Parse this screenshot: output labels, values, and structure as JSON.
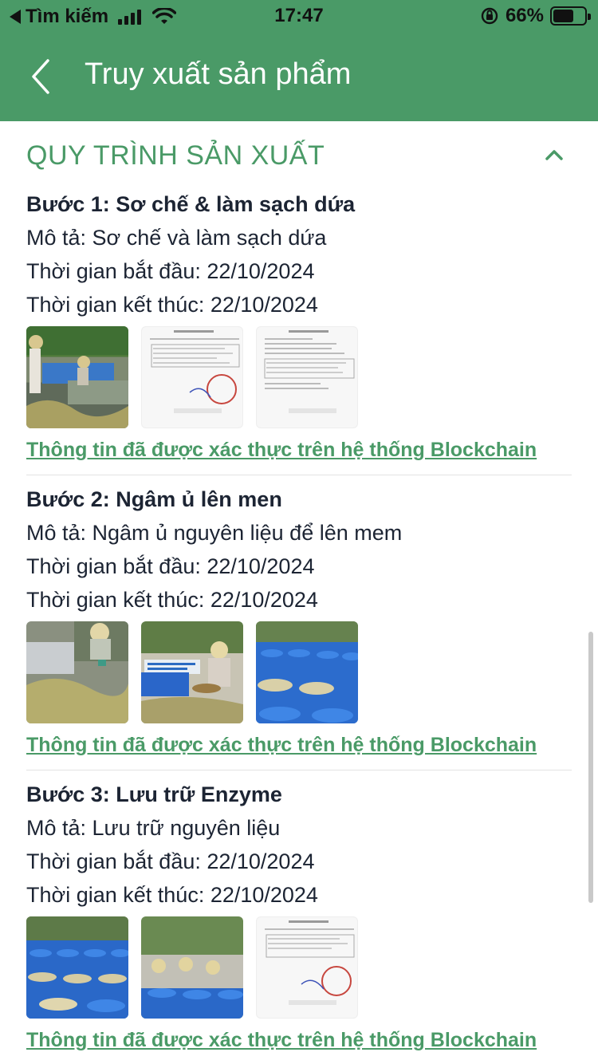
{
  "status_bar": {
    "back_app": "Tìm kiếm",
    "time": "17:47",
    "battery": "66%",
    "battery_level": 0.66
  },
  "header": {
    "title": "Truy xuất sản phẩm"
  },
  "section": {
    "title": "QUY TRÌNH SẢN XUẤT"
  },
  "steps": [
    {
      "name": "Bước 1: Sơ chế & làm sạch dứa",
      "description": "Mô tả: Sơ chế và làm sạch dứa",
      "start": "Thời gian bắt đầu: 22/10/2024",
      "end": "Thời gian kết thúc: 22/10/2024",
      "images": [
        "photo",
        "document",
        "document"
      ],
      "verify_link": "Thông tin đã được xác thực trên hệ thống Blockchain"
    },
    {
      "name": "Bước 2: Ngâm ủ lên men",
      "description": "Mô tả: Ngâm ủ nguyên liệu để lên mem",
      "start": "Thời gian bắt đầu: 22/10/2024",
      "end": "Thời gian kết thúc: 22/10/2024",
      "images": [
        "photo",
        "photo",
        "photo"
      ],
      "verify_link": "Thông tin đã được xác thực trên hệ thống Blockchain"
    },
    {
      "name": "Bước 3: Lưu trữ Enzyme",
      "description": "Mô tả: Lưu trữ nguyên liệu",
      "start": "Thời gian bắt đầu: 22/10/2024",
      "end": "Thời gian kết thúc: 22/10/2024",
      "images": [
        "photo",
        "photo",
        "document"
      ],
      "verify_link": "Thông tin đã được xác thực trên hệ thống Blockchain"
    }
  ],
  "colors": {
    "brand_green": "#4a9a67",
    "text": "#1c2433"
  }
}
